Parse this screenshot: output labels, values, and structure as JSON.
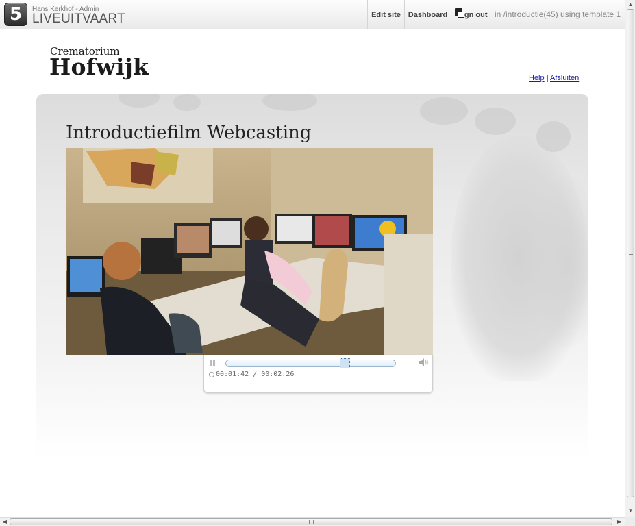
{
  "admin_bar": {
    "logo_number": "5",
    "user": "Hans Kerkhof - Admin",
    "site_name": "LIVEUITVAART",
    "edit_site": "Edit site",
    "dashboard": "Dashboard",
    "sign_out": "Sign out",
    "template_info": "in /introductie(45) using template 1"
  },
  "site": {
    "logo_top": "Crematorium",
    "logo_main": "Hofwijk",
    "help_link": "Help",
    "separator": "|",
    "exit_link": "Afsluiten"
  },
  "page": {
    "title": "Introductiefilm Webcasting"
  },
  "player": {
    "time": "00:01:42 / 00:02:26",
    "progress": 0.7
  },
  "colors": {
    "link": "#1a1aa6",
    "progress_border": "#9ab6cf",
    "thumb": "#cfe2f3"
  }
}
